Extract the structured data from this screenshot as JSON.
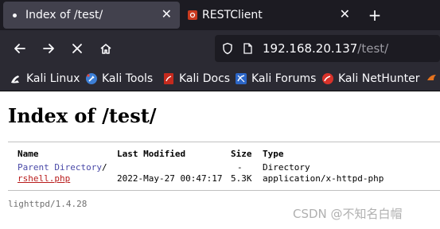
{
  "tabs": [
    {
      "title": "Index of /test/",
      "active": true
    },
    {
      "title": "RESTClient",
      "active": false
    }
  ],
  "new_tab_label": "+",
  "close_label": "✕",
  "url": {
    "host": "192.168.20.137",
    "path": "/test/"
  },
  "bookmarks": [
    {
      "label": "Kali Linux",
      "icon": "kali-dragon-icon"
    },
    {
      "label": "Kali Tools",
      "icon": "kali-tools-icon"
    },
    {
      "label": "Kali Docs",
      "icon": "kali-docs-icon"
    },
    {
      "label": "Kali Forums",
      "icon": "kali-forums-icon"
    },
    {
      "label": "Kali NetHunter",
      "icon": "kali-nethunter-icon"
    }
  ],
  "page": {
    "title": "Index of /test/",
    "columns": [
      "Name",
      "Last Modified",
      "Size",
      "Type"
    ],
    "rows": [
      {
        "name": "Parent Directory",
        "suffix": "/",
        "modified": "",
        "size": "-",
        "type": "Directory"
      },
      {
        "name": "rshell.php",
        "suffix": "",
        "modified": "2022-May-27 00:47:17",
        "size": "5.3K",
        "type": "application/x-httpd-php"
      }
    ],
    "footer": "lighttpd/1.4.28"
  },
  "watermark": "CSDN @不知名白帽",
  "colors": {
    "chrome_bg": "#1c1b22",
    "toolbar_bg": "#2b2a33",
    "active_tab": "#42414d",
    "dir_link": "#4a4aa8",
    "file_link": "#b81c1c"
  }
}
